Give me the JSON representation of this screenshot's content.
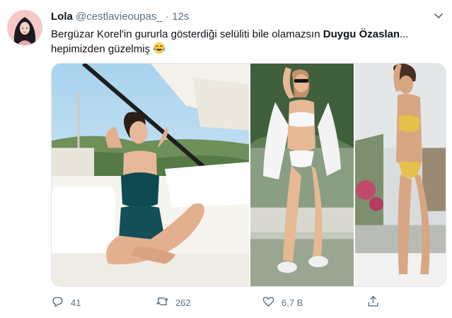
{
  "tweet": {
    "author_name": "Lola",
    "author_handle": "@cestlavieoupas_",
    "separator": "·",
    "timestamp": "12s",
    "text_part1": "Bergüzar Korel'in gururla gösterdiği selüliti bile olamazsın ",
    "text_bold": "Duygu Özaslan",
    "text_part2": "... hepimizden güzelmiş",
    "emoji": "face-with-tears-of-joy"
  },
  "actions": {
    "reply_count": "41",
    "retweet_count": "262",
    "like_count": "6,7 B"
  },
  "colors": {
    "secondary_text": "#5b7083",
    "avatar_bg": "#f6c9c9",
    "media_border": "#e3e8ec"
  },
  "icons": [
    "avatar",
    "chevron-down-icon",
    "reply-icon",
    "retweet-icon",
    "like-icon",
    "share-icon"
  ]
}
